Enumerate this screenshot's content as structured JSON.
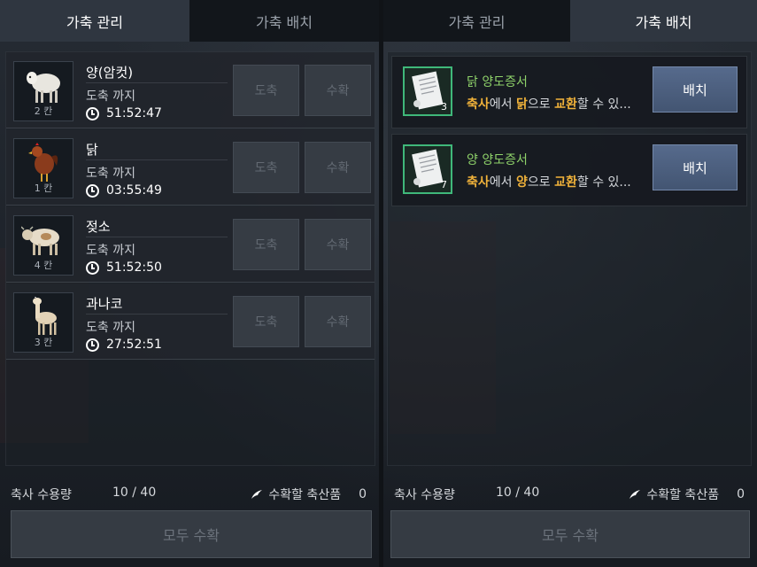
{
  "tabs": [
    "가축 관리",
    "가축 배치",
    "가축 관리",
    "가축 배치"
  ],
  "animals": [
    {
      "name": "양(암컷)",
      "size": "2 칸",
      "until": "도축 까지",
      "timer": "51:52:47",
      "icon": "sheep-icon"
    },
    {
      "name": "닭",
      "size": "1 칸",
      "until": "도축 까지",
      "timer": "03:55:49",
      "icon": "chicken-icon"
    },
    {
      "name": "젖소",
      "size": "4 칸",
      "until": "도축 까지",
      "timer": "51:52:50",
      "icon": "cow-icon"
    },
    {
      "name": "과나코",
      "size": "3 칸",
      "until": "도축 까지",
      "timer": "27:52:51",
      "icon": "guanaco-icon"
    }
  ],
  "buttons": {
    "slaughter": "도축",
    "harvest": "수확",
    "place": "배치",
    "harvest_all": "모두 수확"
  },
  "certificates": [
    {
      "title": "닭 양도증서",
      "count": "3",
      "desc_pre": "축사",
      "desc_mid1": "에서 ",
      "desc_animal": "닭",
      "desc_mid2": "으로 ",
      "desc_hl2": "교환",
      "desc_post": "할 수 있...",
      "icon": "scroll-icon"
    },
    {
      "title": "양 양도증서",
      "count": "7",
      "desc_pre": "축사",
      "desc_mid1": "에서 ",
      "desc_animal": "양",
      "desc_mid2": "으로 ",
      "desc_hl2": "교환",
      "desc_post": "할 수 있...",
      "icon": "scroll-icon"
    }
  ],
  "footer": {
    "capacity_label": "축사 수용량",
    "capacity_value": "10 / 40",
    "harvest_label": "수확할 축산품",
    "harvest_count": "0"
  },
  "colors": {
    "accent_green": "#8fd36a",
    "highlight_gold": "#f0b23a",
    "place_button": "#4b5e7e"
  }
}
